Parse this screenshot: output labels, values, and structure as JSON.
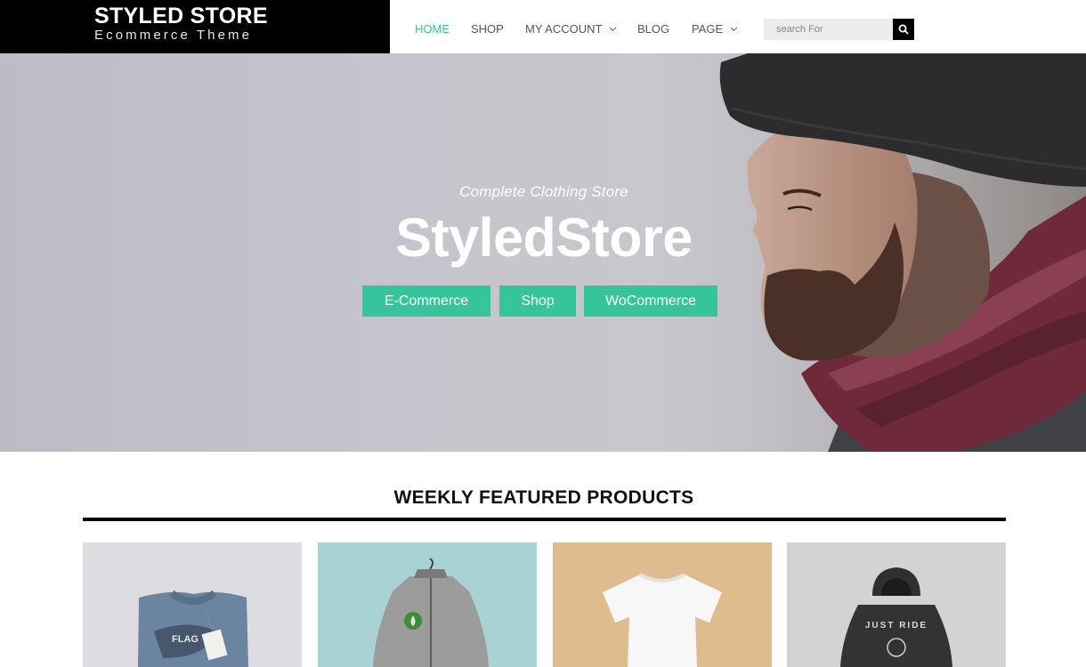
{
  "brand": {
    "title": "STYLED STORE",
    "subtitle": "Ecommerce Theme"
  },
  "nav": {
    "items": [
      {
        "label": "HOME",
        "active": true
      },
      {
        "label": "SHOP"
      },
      {
        "label": "MY ACCOUNT",
        "dropdown": true
      },
      {
        "label": "BLOG"
      },
      {
        "label": "PAGE",
        "dropdown": true
      }
    ],
    "search_placeholder": "search For"
  },
  "hero": {
    "tagline": "Complete Clothing Store",
    "title": "StyledStore",
    "buttons": [
      "E-Commerce",
      "Shop",
      "WoCommerce"
    ]
  },
  "featured": {
    "title": "WEEKLY FEATURED PRODUCTS",
    "products": [
      {
        "name": "folded-sweatshirt",
        "graphic_text": "FLAG",
        "background": "#dcdce0"
      },
      {
        "name": "grey-zip-jacket",
        "background": "#a9d3d5"
      },
      {
        "name": "white-tshirt",
        "background": "#dfbc8e"
      },
      {
        "name": "black-hoodie",
        "graphic_text": "JUST RIDE",
        "background": "#d4d4d4"
      }
    ]
  },
  "colors": {
    "accent": "#36c49b",
    "header_bg": "#000000"
  }
}
